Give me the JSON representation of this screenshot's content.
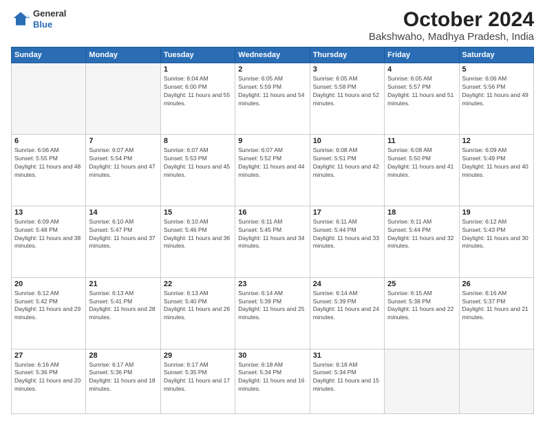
{
  "header": {
    "logo_general": "General",
    "logo_blue": "Blue",
    "title": "October 2024",
    "subtitle": "Bakshwaho, Madhya Pradesh, India"
  },
  "weekdays": [
    "Sunday",
    "Monday",
    "Tuesday",
    "Wednesday",
    "Thursday",
    "Friday",
    "Saturday"
  ],
  "weeks": [
    [
      {
        "day": "",
        "info": ""
      },
      {
        "day": "",
        "info": ""
      },
      {
        "day": "1",
        "info": "Sunrise: 6:04 AM\nSunset: 6:00 PM\nDaylight: 11 hours and 55 minutes."
      },
      {
        "day": "2",
        "info": "Sunrise: 6:05 AM\nSunset: 5:59 PM\nDaylight: 11 hours and 54 minutes."
      },
      {
        "day": "3",
        "info": "Sunrise: 6:05 AM\nSunset: 5:58 PM\nDaylight: 11 hours and 52 minutes."
      },
      {
        "day": "4",
        "info": "Sunrise: 6:05 AM\nSunset: 5:57 PM\nDaylight: 11 hours and 51 minutes."
      },
      {
        "day": "5",
        "info": "Sunrise: 6:06 AM\nSunset: 5:56 PM\nDaylight: 11 hours and 49 minutes."
      }
    ],
    [
      {
        "day": "6",
        "info": "Sunrise: 6:06 AM\nSunset: 5:55 PM\nDaylight: 11 hours and 48 minutes."
      },
      {
        "day": "7",
        "info": "Sunrise: 6:07 AM\nSunset: 5:54 PM\nDaylight: 11 hours and 47 minutes."
      },
      {
        "day": "8",
        "info": "Sunrise: 6:07 AM\nSunset: 5:53 PM\nDaylight: 11 hours and 45 minutes."
      },
      {
        "day": "9",
        "info": "Sunrise: 6:07 AM\nSunset: 5:52 PM\nDaylight: 11 hours and 44 minutes."
      },
      {
        "day": "10",
        "info": "Sunrise: 6:08 AM\nSunset: 5:51 PM\nDaylight: 11 hours and 42 minutes."
      },
      {
        "day": "11",
        "info": "Sunrise: 6:08 AM\nSunset: 5:50 PM\nDaylight: 11 hours and 41 minutes."
      },
      {
        "day": "12",
        "info": "Sunrise: 6:09 AM\nSunset: 5:49 PM\nDaylight: 11 hours and 40 minutes."
      }
    ],
    [
      {
        "day": "13",
        "info": "Sunrise: 6:09 AM\nSunset: 5:48 PM\nDaylight: 11 hours and 38 minutes."
      },
      {
        "day": "14",
        "info": "Sunrise: 6:10 AM\nSunset: 5:47 PM\nDaylight: 11 hours and 37 minutes."
      },
      {
        "day": "15",
        "info": "Sunrise: 6:10 AM\nSunset: 5:46 PM\nDaylight: 11 hours and 36 minutes."
      },
      {
        "day": "16",
        "info": "Sunrise: 6:11 AM\nSunset: 5:45 PM\nDaylight: 11 hours and 34 minutes."
      },
      {
        "day": "17",
        "info": "Sunrise: 6:11 AM\nSunset: 5:44 PM\nDaylight: 11 hours and 33 minutes."
      },
      {
        "day": "18",
        "info": "Sunrise: 6:11 AM\nSunset: 5:44 PM\nDaylight: 11 hours and 32 minutes."
      },
      {
        "day": "19",
        "info": "Sunrise: 6:12 AM\nSunset: 5:43 PM\nDaylight: 11 hours and 30 minutes."
      }
    ],
    [
      {
        "day": "20",
        "info": "Sunrise: 6:12 AM\nSunset: 5:42 PM\nDaylight: 11 hours and 29 minutes."
      },
      {
        "day": "21",
        "info": "Sunrise: 6:13 AM\nSunset: 5:41 PM\nDaylight: 11 hours and 28 minutes."
      },
      {
        "day": "22",
        "info": "Sunrise: 6:13 AM\nSunset: 5:40 PM\nDaylight: 11 hours and 26 minutes."
      },
      {
        "day": "23",
        "info": "Sunrise: 6:14 AM\nSunset: 5:39 PM\nDaylight: 11 hours and 25 minutes."
      },
      {
        "day": "24",
        "info": "Sunrise: 6:14 AM\nSunset: 5:39 PM\nDaylight: 11 hours and 24 minutes."
      },
      {
        "day": "25",
        "info": "Sunrise: 6:15 AM\nSunset: 5:38 PM\nDaylight: 11 hours and 22 minutes."
      },
      {
        "day": "26",
        "info": "Sunrise: 6:16 AM\nSunset: 5:37 PM\nDaylight: 11 hours and 21 minutes."
      }
    ],
    [
      {
        "day": "27",
        "info": "Sunrise: 6:16 AM\nSunset: 5:36 PM\nDaylight: 11 hours and 20 minutes."
      },
      {
        "day": "28",
        "info": "Sunrise: 6:17 AM\nSunset: 5:36 PM\nDaylight: 11 hours and 18 minutes."
      },
      {
        "day": "29",
        "info": "Sunrise: 6:17 AM\nSunset: 5:35 PM\nDaylight: 11 hours and 17 minutes."
      },
      {
        "day": "30",
        "info": "Sunrise: 6:18 AM\nSunset: 5:34 PM\nDaylight: 11 hours and 16 minutes."
      },
      {
        "day": "31",
        "info": "Sunrise: 6:18 AM\nSunset: 5:34 PM\nDaylight: 11 hours and 15 minutes."
      },
      {
        "day": "",
        "info": ""
      },
      {
        "day": "",
        "info": ""
      }
    ]
  ]
}
